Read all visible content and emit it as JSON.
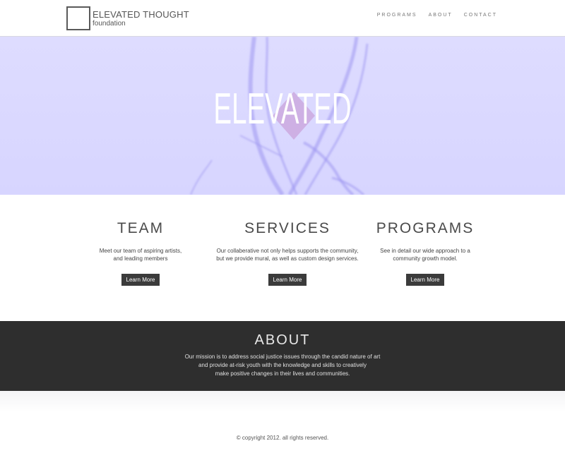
{
  "header": {
    "logo_title": "ELEVATED THOUGHT",
    "logo_sub": "foundation",
    "nav": [
      "PROGRAMS",
      "ABOUT",
      "CONTACT"
    ]
  },
  "hero": {
    "word": "ELEVATED",
    "bg_color": "#dcdaff"
  },
  "columns": [
    {
      "title": "TEAM",
      "text_lines": [
        "Meet our team of aspiring artists,",
        "and leading members"
      ],
      "button": "Learn More"
    },
    {
      "title": "SERVICES",
      "text_lines": [
        "Our collaberative not only helps supports the community,",
        "but we provide mural, as well as  custom design services."
      ],
      "button": "Learn More"
    },
    {
      "title": "PROGRAMS",
      "text_lines": [
        "See in detail our wide approach  to a",
        "community growth model."
      ],
      "button": "Learn More"
    }
  ],
  "about": {
    "title": "ABOUT",
    "lines": [
      "Our mission is to address social justice issues through the candid nature of art",
      "and provide at-risk youth with the knowledge and skills to creatively",
      "make positive changes in their lives and communities."
    ]
  },
  "footer": {
    "copyright": "© copyright 2012. all rights reserved."
  }
}
